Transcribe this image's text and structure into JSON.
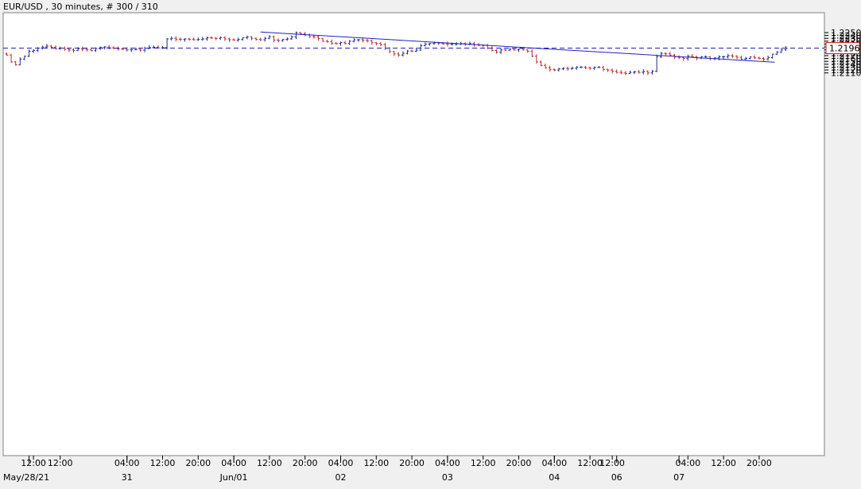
{
  "header": {
    "title": "EUR/USD , 30 minutes, # 300 / 310"
  },
  "chart_data": {
    "type": "ohlc",
    "title": "EUR/USD , 30 minutes, # 300 / 310",
    "symbol": "EUR/USD",
    "interval": "30 minutes",
    "bar_count_label": "# 300 / 310",
    "ylim": [
      1.21,
      1.2258
    ],
    "y_ticks": [
      "1.2110",
      "1.2120",
      "1.2130",
      "1.2140",
      "1.2150",
      "1.2160",
      "1.2170",
      "1.2180",
      "1.2190",
      "1.2200",
      "1.2210",
      "1.2220",
      "1.2230",
      "1.2240",
      "1.2250"
    ],
    "y_tick_values": [
      1.211,
      1.212,
      1.213,
      1.214,
      1.215,
      1.216,
      1.217,
      1.218,
      1.219,
      1.22,
      1.221,
      1.222,
      1.223,
      1.224,
      1.225
    ],
    "current_price": {
      "value": 1.2196,
      "label": "1.2196"
    },
    "x_axis": {
      "time_labels": [
        {
          "bar": 6,
          "text": "12:00"
        },
        {
          "bar": 12,
          "text": "12:00"
        },
        {
          "bar": 27,
          "text": "04:00"
        },
        {
          "bar": 35,
          "text": "12:00"
        },
        {
          "bar": 43,
          "text": "20:00"
        },
        {
          "bar": 51,
          "text": "04:00"
        },
        {
          "bar": 59,
          "text": "12:00"
        },
        {
          "bar": 67,
          "text": "20:00"
        },
        {
          "bar": 75,
          "text": "04:00"
        },
        {
          "bar": 83,
          "text": "12:00"
        },
        {
          "bar": 91,
          "text": "20:00"
        },
        {
          "bar": 99,
          "text": "04:00"
        },
        {
          "bar": 107,
          "text": "12:00"
        },
        {
          "bar": 115,
          "text": "20:00"
        },
        {
          "bar": 123,
          "text": "04:00"
        },
        {
          "bar": 131,
          "text": "12:00"
        },
        {
          "bar": 136,
          "text": "12:00"
        },
        {
          "bar": 153,
          "text": "04:00"
        },
        {
          "bar": 161,
          "text": "12:00"
        },
        {
          "bar": 169,
          "text": "20:00"
        }
      ],
      "date_labels": [
        {
          "bar": 5,
          "text": "May/28/21"
        },
        {
          "bar": 27,
          "text": "31"
        },
        {
          "bar": 51,
          "text": "Jun/01"
        },
        {
          "bar": 75,
          "text": "02"
        },
        {
          "bar": 99,
          "text": "03"
        },
        {
          "bar": 123,
          "text": "04"
        },
        {
          "bar": 137,
          "text": "06"
        },
        {
          "bar": 151,
          "text": "07"
        }
      ]
    },
    "trendline": {
      "start": {
        "bar": 57,
        "price": 1.2252
      },
      "end": {
        "bar": 172.5,
        "price": 1.2147
      }
    },
    "closes": [
      1.2172,
      1.2148,
      1.2138,
      1.2158,
      1.2168,
      1.2185,
      1.2188,
      1.2196,
      1.22,
      1.2203,
      1.2199,
      1.2194,
      1.2196,
      1.2192,
      1.219,
      1.2188,
      1.2194,
      1.2192,
      1.219,
      1.2187,
      1.2195,
      1.2198,
      1.22,
      1.2197,
      1.2195,
      1.2193,
      1.2192,
      1.219,
      1.2191,
      1.2192,
      1.2189,
      1.2195,
      1.2198,
      1.2199,
      1.2197,
      1.2198,
      1.2228,
      1.223,
      1.2227,
      1.2226,
      1.2228,
      1.2227,
      1.2225,
      1.2226,
      1.2228,
      1.2232,
      1.2231,
      1.223,
      1.2233,
      1.2228,
      1.2225,
      1.2224,
      1.2226,
      1.2232,
      1.2235,
      1.223,
      1.2226,
      1.2225,
      1.223,
      1.2236,
      1.2224,
      1.2222,
      1.2226,
      1.2228,
      1.2235,
      1.225,
      1.2246,
      1.2242,
      1.2236,
      1.2235,
      1.2229,
      1.222,
      1.2218,
      1.2213,
      1.2212,
      1.2215,
      1.2212,
      1.222,
      1.2225,
      1.2225,
      1.2223,
      1.2222,
      1.2215,
      1.2212,
      1.2208,
      1.2196,
      1.2184,
      1.2176,
      1.2172,
      1.2178,
      1.2186,
      1.2185,
      1.2189,
      1.2205,
      1.221,
      1.2212,
      1.2214,
      1.2212,
      1.2211,
      1.2209,
      1.2209,
      1.2211,
      1.2212,
      1.221,
      1.2212,
      1.2208,
      1.2206,
      1.2205,
      1.2196,
      1.2188,
      1.2182,
      1.219,
      1.2189,
      1.2192,
      1.219,
      1.2193,
      1.219,
      1.2185,
      1.2168,
      1.2148,
      1.2136,
      1.2128,
      1.2122,
      1.212,
      1.2124,
      1.2126,
      1.2124,
      1.2126,
      1.213,
      1.213,
      1.2128,
      1.2126,
      1.2129,
      1.2129,
      1.2122,
      1.212,
      1.2116,
      1.2112,
      1.211,
      1.2108,
      1.2112,
      1.2114,
      1.2112,
      1.2115,
      1.211,
      1.2116,
      1.2166,
      1.2178,
      1.2176,
      1.2172,
      1.2165,
      1.2164,
      1.216,
      1.2168,
      1.2166,
      1.2162,
      1.2166,
      1.2166,
      1.216,
      1.2162,
      1.2166,
      1.2166,
      1.217,
      1.2168,
      1.2164,
      1.2158,
      1.216,
      1.2165,
      1.2162,
      1.216,
      1.2158,
      1.2163,
      1.2175,
      1.2182,
      1.219,
      1.2196
    ]
  }
}
